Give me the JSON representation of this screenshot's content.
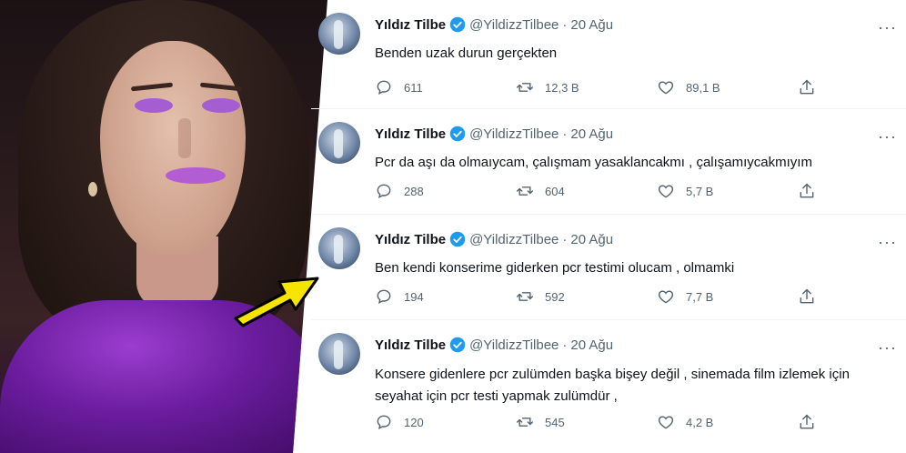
{
  "tweets": [
    {
      "name": "Yıldız Tilbe",
      "handle": "@YildizzTilbee",
      "date": "20 Ağu",
      "text": "Benden uzak durun gerçekten",
      "replies": "611",
      "retweets": "12,3 B",
      "likes": "89,1 B"
    },
    {
      "name": "Yıldız Tilbe",
      "handle": "@YildizzTilbee",
      "date": "20 Ağu",
      "text": "Pcr da aşı da olmaıycam, çalışmam yasaklancakmı , çalışamıycakmıyım",
      "replies": "288",
      "retweets": "604",
      "likes": "5,7 B"
    },
    {
      "name": "Yıldız Tilbe",
      "handle": "@YildizzTilbee",
      "date": "20 Ağu",
      "text": "Ben kendi konserime giderken pcr testimi olucam , olmamki",
      "replies": "194",
      "retweets": "592",
      "likes": "7,7 B"
    },
    {
      "name": "Yıldız Tilbe",
      "handle": "@YildizzTilbee",
      "date": "20 Ağu",
      "text": "Konsere gidenlere pcr zulümden başka bişey değil , sinemada film izlemek için seyahat için pcr testi yapmak zulümdür ,",
      "replies": "120",
      "retweets": "545",
      "likes": "4,2 B"
    }
  ],
  "ui": {
    "dot": "·",
    "more": "···"
  },
  "colors": {
    "verified": "#1d9bf0",
    "muted": "#536471",
    "arrow": "#f5e400"
  }
}
